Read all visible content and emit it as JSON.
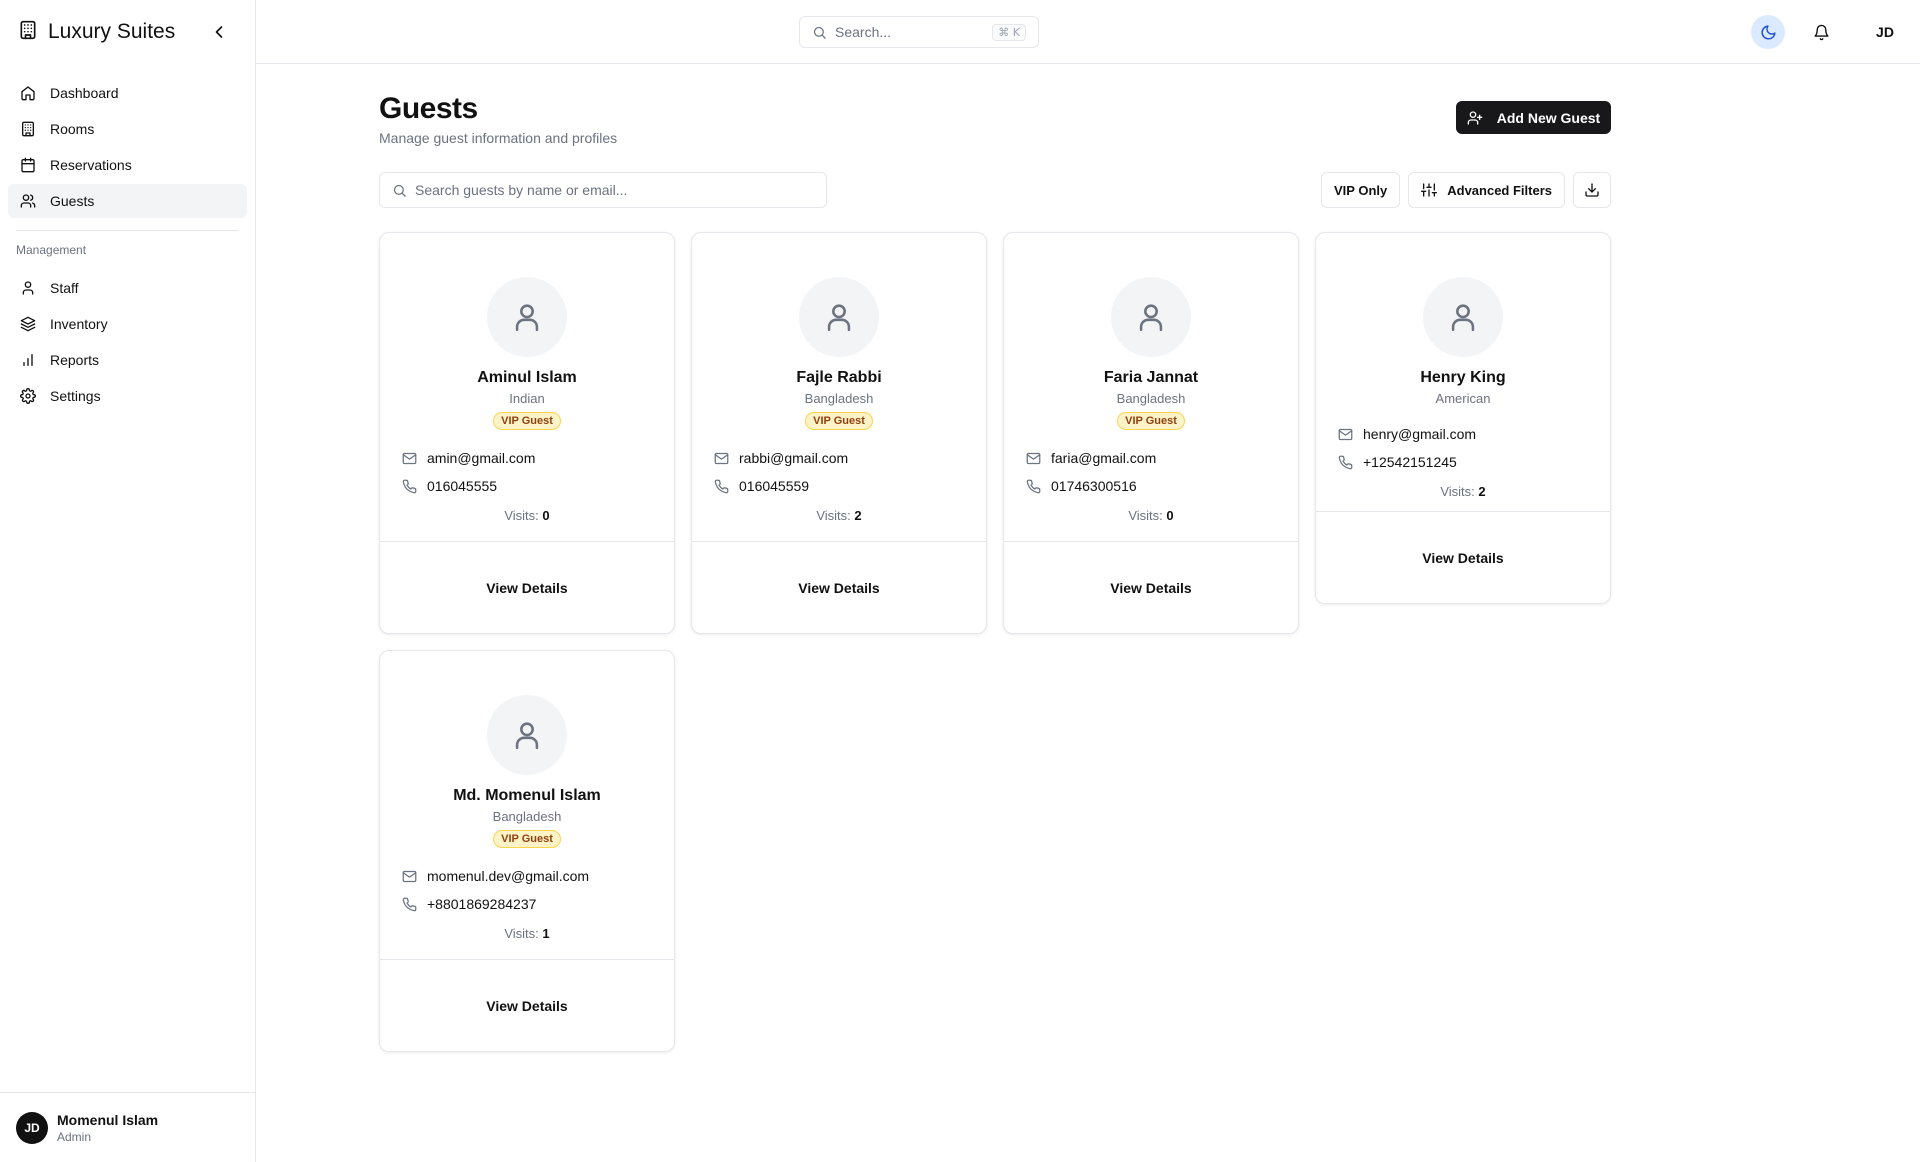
{
  "app": {
    "title": "Luxury Suites"
  },
  "sidebar": {
    "items": [
      {
        "label": "Dashboard",
        "icon": "home-icon"
      },
      {
        "label": "Rooms",
        "icon": "building-icon"
      },
      {
        "label": "Reservations",
        "icon": "calendar-icon"
      },
      {
        "label": "Guests",
        "icon": "users-icon",
        "active": true
      }
    ],
    "section_title": "Management",
    "management_items": [
      {
        "label": "Staff",
        "icon": "user-icon"
      },
      {
        "label": "Inventory",
        "icon": "layers-icon"
      },
      {
        "label": "Reports",
        "icon": "bar-chart-icon"
      },
      {
        "label": "Settings",
        "icon": "gear-icon"
      }
    ],
    "user": {
      "initials": "JD",
      "name": "Momenul Islam",
      "role": "Admin"
    }
  },
  "topbar": {
    "search_placeholder": "Search...",
    "shortcut": "⌘ K",
    "avatar_initials": "JD"
  },
  "page": {
    "title": "Guests",
    "subtitle": "Manage guest information and profiles",
    "add_button": "Add New Guest",
    "search_placeholder": "Search guests by name or email...",
    "vip_filter": "VIP Only",
    "advanced_filters": "Advanced Filters"
  },
  "guests": [
    {
      "name": "Aminul Islam",
      "nationality": "Indian",
      "badge": "VIP Guest",
      "email": "amin@gmail.com",
      "phone": "016045555",
      "visits_label": "Visits:",
      "visits": "0",
      "action": "View Details"
    },
    {
      "name": "Fajle Rabbi",
      "nationality": "Bangladesh",
      "badge": "VIP Guest",
      "email": "rabbi@gmail.com",
      "phone": "016045559",
      "visits_label": "Visits:",
      "visits": "2",
      "action": "View Details"
    },
    {
      "name": "Faria Jannat",
      "nationality": "Bangladesh",
      "badge": "VIP Guest",
      "email": "faria@gmail.com",
      "phone": "01746300516",
      "visits_label": "Visits:",
      "visits": "0",
      "action": "View Details"
    },
    {
      "name": "Henry King",
      "nationality": "American",
      "badge": "",
      "email": "henry@gmail.com",
      "phone": "+12542151245",
      "visits_label": "Visits:",
      "visits": "2",
      "action": "View Details"
    },
    {
      "name": "Md. Momenul Islam",
      "nationality": "Bangladesh",
      "badge": "VIP Guest",
      "email": "momenul.dev@gmail.com",
      "phone": "+8801869284237",
      "visits_label": "Visits:",
      "visits": "1",
      "action": "View Details"
    }
  ],
  "colors": {
    "vip_badge_bg": "#fef3c7",
    "vip_badge_text": "#92400e",
    "primary_button": "#18181b",
    "theme_toggle_bg": "#dbeafe"
  }
}
